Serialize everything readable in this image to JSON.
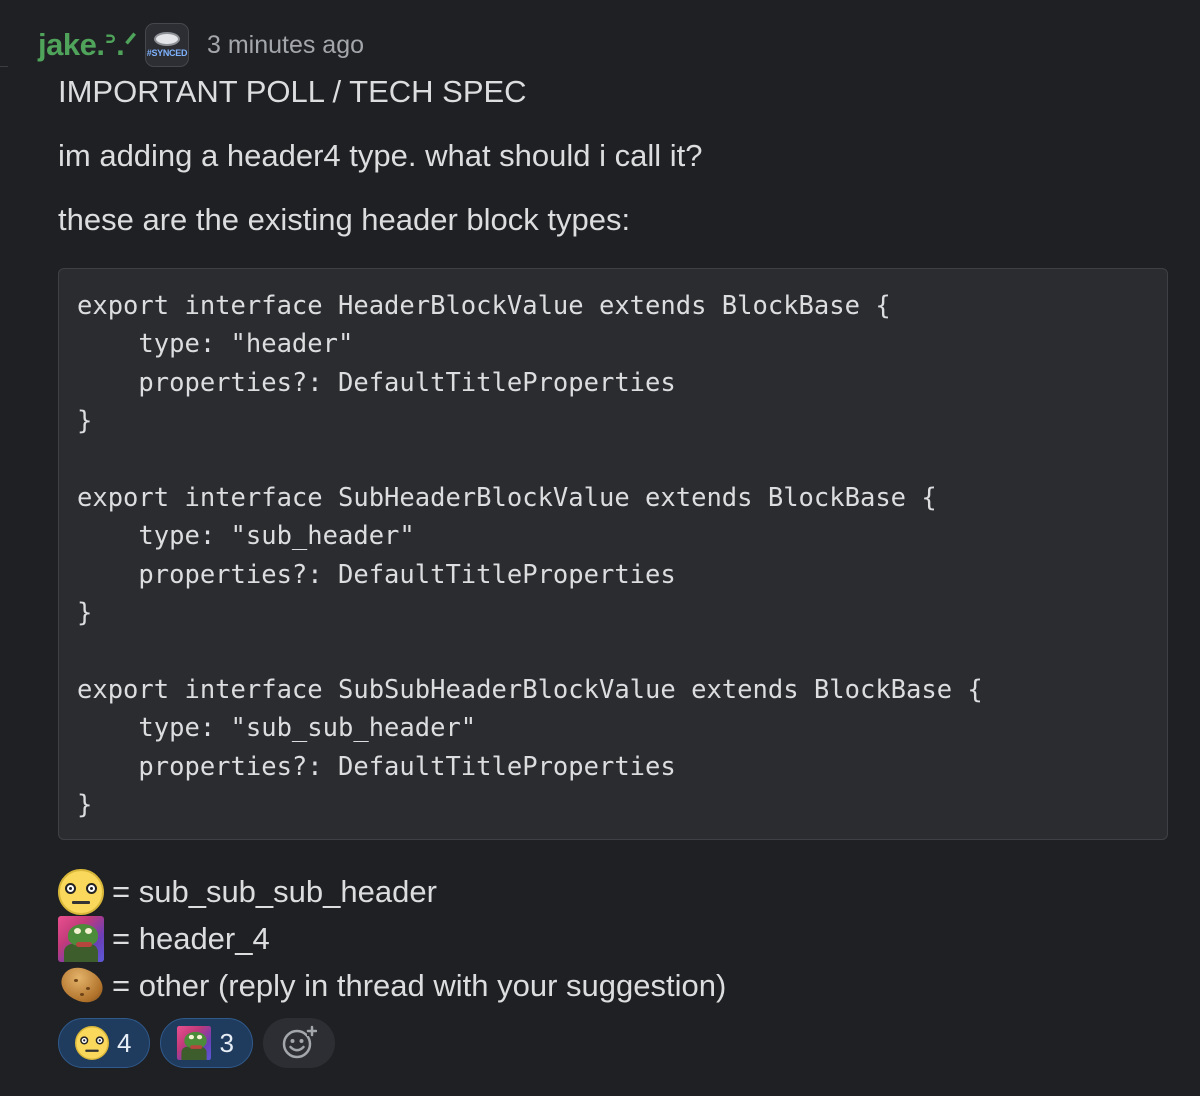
{
  "message": {
    "author": "jake.ᐣ.ᐟ",
    "badge_text": "#SYNCED",
    "timestamp": "3 minutes ago",
    "title": "IMPORTANT POLL / TECH SPEC",
    "question": "im adding a header4 type. what should i call it?",
    "intro": "these are the existing header block types:",
    "code": "export interface HeaderBlockValue extends BlockBase {\n    type: \"header\"\n    properties?: DefaultTitleProperties\n}\n\nexport interface SubHeaderBlockValue extends BlockBase {\n    type: \"sub_header\"\n    properties?: DefaultTitleProperties\n}\n\nexport interface SubSubHeaderBlockValue extends BlockBase {\n    type: \"sub_sub_header\"\n    properties?: DefaultTitleProperties\n}",
    "options": [
      {
        "emoji": "unimpressed-face-emoji",
        "text": "= sub_sub_sub_header"
      },
      {
        "emoji": "frog-emoji",
        "text": "= header_4"
      },
      {
        "emoji": "potato-emoji",
        "text": "= other (reply in thread with your suggestion)"
      }
    ]
  },
  "reactions": [
    {
      "emoji": "unimpressed-face-emoji",
      "count": "4"
    },
    {
      "emoji": "frog-emoji",
      "count": "3"
    }
  ],
  "add_reaction_icon": "add-reaction-icon",
  "colors": {
    "background": "#1f2023",
    "author": "#4fa35a",
    "code_background": "#2a2c30",
    "reaction_active": "#1f3b5e"
  }
}
